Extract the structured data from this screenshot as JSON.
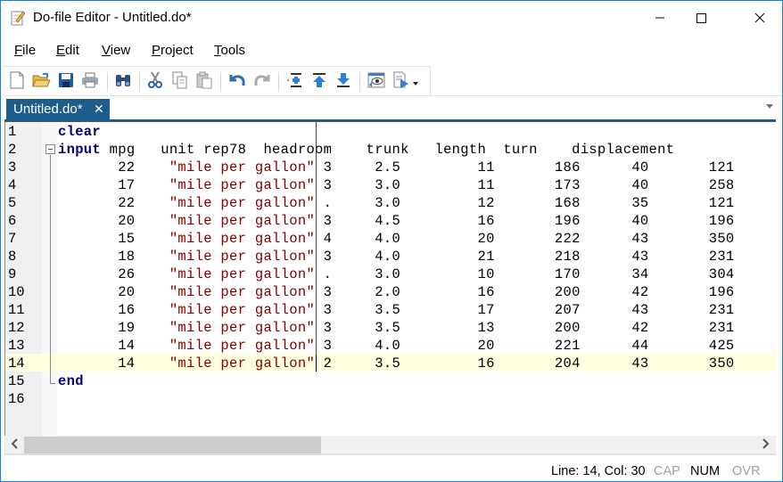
{
  "window": {
    "title": "Do-file Editor - Untitled.do*",
    "icon": "notepad-pencil-icon",
    "controls": [
      "minimize",
      "maximize",
      "close"
    ]
  },
  "menu": {
    "items": [
      {
        "label": "File",
        "underline": "F",
        "rest": "ile"
      },
      {
        "label": "Edit",
        "underline": "E",
        "rest": "dit"
      },
      {
        "label": "View",
        "underline": "V",
        "rest": "iew"
      },
      {
        "label": "Project",
        "underline": "P",
        "rest": "roject"
      },
      {
        "label": "Tools",
        "underline": "T",
        "rest": "ools"
      }
    ]
  },
  "toolbar": {
    "buttons": [
      "new-file-icon",
      "open-folder-icon",
      "save-icon",
      "print-icon",
      "find-binoculars-icon",
      "cut-icon",
      "copy-icon",
      "paste-icon",
      "undo-icon",
      "redo-icon",
      "toggle-bookmark-icon",
      "previous-bookmark-icon",
      "next-bookmark-icon",
      "show-file-in-viewer-icon",
      "execute-do-icon"
    ]
  },
  "tabs": [
    {
      "label": "Untitled.do*",
      "active": true,
      "close_icon": "✕"
    }
  ],
  "editor": {
    "current_line": 14,
    "lines": [
      {
        "n": "1",
        "parts": [
          {
            "t": "clear",
            "c": "kw"
          }
        ]
      },
      {
        "n": "2",
        "parts": [
          {
            "t": "input",
            "c": "kw"
          },
          {
            "t": " mpg   unit rep78  headroom    trunk   length  turn    displacement",
            "c": ""
          }
        ]
      },
      {
        "n": "3",
        "parts": [
          {
            "t": "       22    ",
            "c": ""
          },
          {
            "t": "\"mile per gallon\"",
            "c": "str"
          },
          {
            "t": " 3     2.5         11       186      40       121",
            "c": ""
          }
        ]
      },
      {
        "n": "4",
        "parts": [
          {
            "t": "       17    ",
            "c": ""
          },
          {
            "t": "\"mile per gallon\"",
            "c": "str"
          },
          {
            "t": " 3     3.0         11       173      40       258",
            "c": ""
          }
        ]
      },
      {
        "n": "5",
        "parts": [
          {
            "t": "       22    ",
            "c": ""
          },
          {
            "t": "\"mile per gallon\"",
            "c": "str"
          },
          {
            "t": " .     3.0         12       168      35       121",
            "c": ""
          }
        ]
      },
      {
        "n": "6",
        "parts": [
          {
            "t": "       20    ",
            "c": ""
          },
          {
            "t": "\"mile per gallon\"",
            "c": "str"
          },
          {
            "t": " 3     4.5         16       196      40       196",
            "c": ""
          }
        ]
      },
      {
        "n": "7",
        "parts": [
          {
            "t": "       15    ",
            "c": ""
          },
          {
            "t": "\"mile per gallon\"",
            "c": "str"
          },
          {
            "t": " 4     4.0         20       222      43       350",
            "c": ""
          }
        ]
      },
      {
        "n": "8",
        "parts": [
          {
            "t": "       18    ",
            "c": ""
          },
          {
            "t": "\"mile per gallon\"",
            "c": "str"
          },
          {
            "t": " 3     4.0         21       218      43       231",
            "c": ""
          }
        ]
      },
      {
        "n": "9",
        "parts": [
          {
            "t": "       26    ",
            "c": ""
          },
          {
            "t": "\"mile per gallon\"",
            "c": "str"
          },
          {
            "t": " .     3.0         10       170      34       304",
            "c": ""
          }
        ]
      },
      {
        "n": "10",
        "parts": [
          {
            "t": "       20    ",
            "c": ""
          },
          {
            "t": "\"mile per gallon\"",
            "c": "str"
          },
          {
            "t": " 3     2.0         16       200      42       196",
            "c": ""
          }
        ]
      },
      {
        "n": "11",
        "parts": [
          {
            "t": "       16    ",
            "c": ""
          },
          {
            "t": "\"mile per gallon\"",
            "c": "str"
          },
          {
            "t": " 3     3.5         17       207      43       231",
            "c": ""
          }
        ]
      },
      {
        "n": "12",
        "parts": [
          {
            "t": "       19    ",
            "c": ""
          },
          {
            "t": "\"mile per gallon\"",
            "c": "str"
          },
          {
            "t": " 3     3.5         13       200      42       231",
            "c": ""
          }
        ]
      },
      {
        "n": "13",
        "parts": [
          {
            "t": "       14    ",
            "c": ""
          },
          {
            "t": "\"mile per gallon\"",
            "c": "str"
          },
          {
            "t": " 3     4.0         20       221      44       425",
            "c": ""
          }
        ]
      },
      {
        "n": "14",
        "parts": [
          {
            "t": "       14    ",
            "c": ""
          },
          {
            "t": "\"mile per gallon\"",
            "c": "str"
          },
          {
            "t": " 2     3.5         16       204      43       350",
            "c": ""
          }
        ]
      },
      {
        "n": "15",
        "parts": [
          {
            "t": "end",
            "c": "kw"
          }
        ]
      },
      {
        "n": "16",
        "parts": []
      }
    ]
  },
  "scrollbar": {
    "left_arrow": "<",
    "right_arrow": ">"
  },
  "status": {
    "position": "Line: 14, Col: 30",
    "cap": "CAP",
    "num": "NUM",
    "ovr": "OVR",
    "cap_active": false,
    "num_active": true,
    "ovr_active": false
  },
  "colors": {
    "accent": "#1c5d8c",
    "keyword": "#00007f",
    "string": "#7f0000",
    "current_line": "#ffffe0",
    "inactive_status": "#a0a0a0"
  }
}
